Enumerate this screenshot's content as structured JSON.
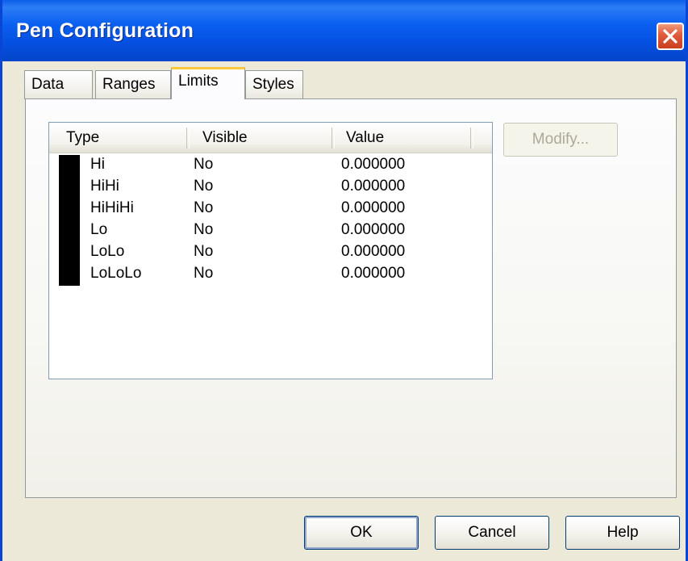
{
  "window": {
    "title": "Pen Configuration"
  },
  "tabs": [
    {
      "label": "Data"
    },
    {
      "label": "Ranges"
    },
    {
      "label": "Limits",
      "active": true
    },
    {
      "label": "Styles"
    }
  ],
  "limits_list": {
    "columns": [
      "Type",
      "Visible",
      "Value"
    ],
    "rows": [
      {
        "type": "Hi",
        "visible": "No",
        "value": "0.000000",
        "color": "#000000"
      },
      {
        "type": "HiHi",
        "visible": "No",
        "value": "0.000000",
        "color": "#000000"
      },
      {
        "type": "HiHiHi",
        "visible": "No",
        "value": "0.000000",
        "color": "#000000"
      },
      {
        "type": "Lo",
        "visible": "No",
        "value": "0.000000",
        "color": "#000000"
      },
      {
        "type": "LoLo",
        "visible": "No",
        "value": "0.000000",
        "color": "#000000"
      },
      {
        "type": "LoLoLo",
        "visible": "No",
        "value": "0.000000",
        "color": "#000000"
      }
    ]
  },
  "buttons": {
    "modify": "Modify...",
    "ok": "OK",
    "cancel": "Cancel",
    "help": "Help"
  },
  "icons": {
    "close": "close-icon"
  },
  "colors": {
    "titlebar": "#0a5ff0",
    "close": "#e0593a",
    "active_tab_accent": "#ffc83c"
  }
}
